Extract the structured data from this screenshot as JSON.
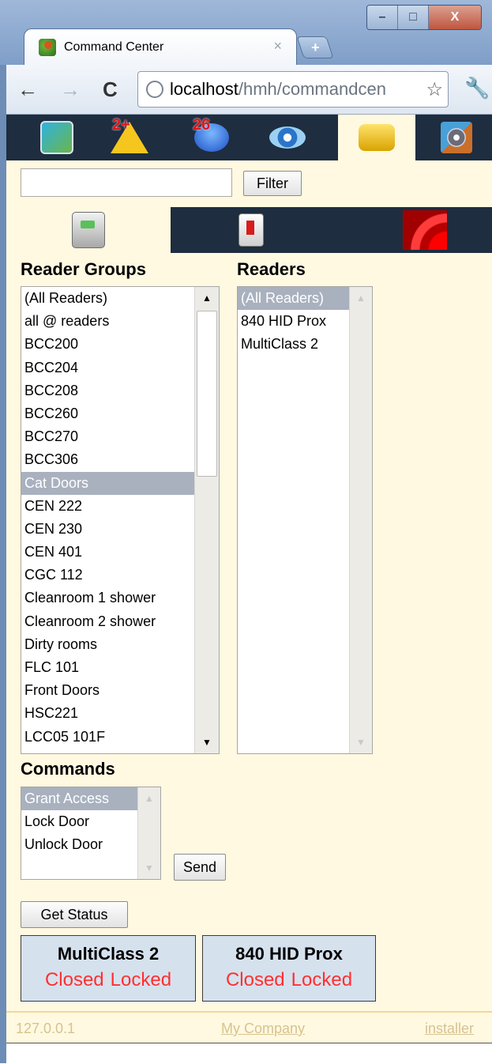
{
  "window": {
    "controls": [
      "–",
      "□",
      "X"
    ]
  },
  "tab": {
    "title": "Command Center",
    "close": "×",
    "new_tab": "+"
  },
  "toolbar": {
    "back": "←",
    "forward": "→",
    "reload": "C",
    "url_host": "localhost",
    "url_path": "/hmh/commandcen",
    "star": "☆",
    "wrench": "🔧"
  },
  "iconbar": {
    "items": [
      {
        "icon": "map-icon"
      },
      {
        "icon": "alarms-icon",
        "badge": "2+"
      },
      {
        "icon": "events-icon",
        "badge": "26"
      },
      {
        "icon": "monitor-eye-icon"
      },
      {
        "icon": "command-arrows-icon",
        "active": true
      },
      {
        "icon": "camera-icon"
      }
    ]
  },
  "filter": {
    "value": "",
    "button": "Filter"
  },
  "subtabs": [
    {
      "icon": "door-panel-icon",
      "active": true
    },
    {
      "icon": "reader-icon"
    },
    {
      "icon": "alarm-wave-icon"
    }
  ],
  "reader_groups": {
    "title": "Reader Groups",
    "options": [
      "(All Readers)",
      "all @ readers",
      "BCC200",
      "BCC204",
      "BCC208",
      "BCC260",
      "BCC270",
      "BCC306",
      "Cat Doors",
      "CEN 222",
      "CEN 230",
      "CEN 401",
      "CGC 112",
      "Cleanroom 1 shower",
      "Cleanroom 2 shower",
      "Dirty rooms",
      "FLC 101",
      "Front Doors",
      "HSC221",
      "LCC05 101F"
    ],
    "selected": "Cat Doors"
  },
  "readers": {
    "title": "Readers",
    "options": [
      "(All Readers)",
      "840 HID Prox",
      "MultiClass 2"
    ],
    "selected": "(All Readers)"
  },
  "commands": {
    "title": "Commands",
    "options": [
      "Grant Access",
      "Lock Door",
      "Unlock Door"
    ],
    "selected": "Grant Access",
    "send": "Send"
  },
  "get_status": "Get Status",
  "status_cards": [
    {
      "name": "MultiClass 2",
      "door": "Closed",
      "lock": "Locked"
    },
    {
      "name": "840 HID Prox",
      "door": "Closed",
      "lock": "Locked"
    }
  ],
  "footer": {
    "ip": "127.0.0.1",
    "company": "My Company",
    "user": "installer"
  },
  "colors": {
    "accent_dark": "#1e2d3f",
    "page_bg": "#fff9e1",
    "status_red": "#ff3030",
    "card_bg": "#d6e1ee",
    "selection": "#a9b1bf"
  }
}
